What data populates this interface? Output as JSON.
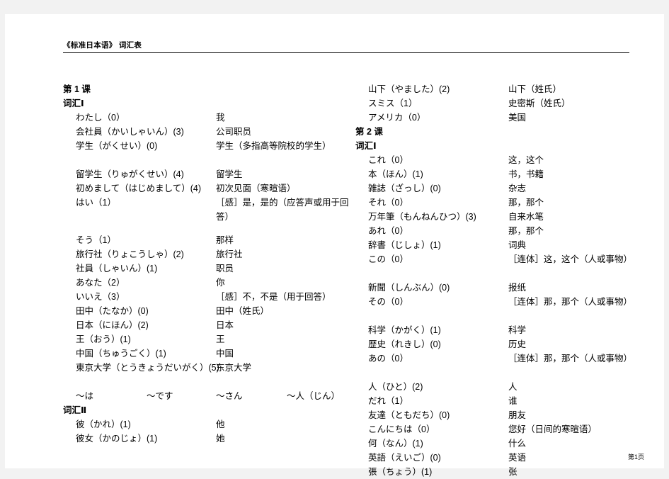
{
  "document": {
    "header_title": "《标准日本语》 词汇表",
    "footer_page": "第1页"
  },
  "left_column": {
    "lesson_heading": "第 1 课",
    "vocab_heading_1": "词汇Ⅰ",
    "vocab_heading_2": "词汇Ⅱ",
    "entries_1": [
      {
        "term": "わたし（0）",
        "gloss": "我"
      },
      {
        "term": "会社員（かいしゃいん）(3)",
        "gloss": "公司职员"
      },
      {
        "term": "学生（がくせい）(0)",
        "gloss": "学生（多指高等院校的学生）"
      },
      {
        "term": "留学生（りゅがくせい）(4)",
        "gloss": "留学生"
      },
      {
        "term": "初めまして（はじめまして）(4)",
        "gloss": "初次见面（寒暄语）"
      },
      {
        "term": "はい（1）",
        "gloss": "［感］是，是的（应答声或用于回答）"
      },
      {
        "term": "そう（1）",
        "gloss": "那样"
      },
      {
        "term": "旅行社（りょこうしゃ）(2)",
        "gloss": "旅行社"
      },
      {
        "term": "社員（しゃいん）(1)",
        "gloss": "职员"
      },
      {
        "term": "あなた（2）",
        "gloss": "你"
      },
      {
        "term": "いいえ（3）",
        "gloss": "［感］不，不是（用于回答）"
      },
      {
        "term": "田中（たなか）(0)",
        "gloss": "田中（姓氏）"
      },
      {
        "term": "日本（にほん）(2)",
        "gloss": "日本"
      },
      {
        "term": "王（おう）(1)",
        "gloss": "王"
      },
      {
        "term": "中国（ちゅうごく）(1)",
        "gloss": "中国"
      },
      {
        "term": "東京大学（とうきょうだいがく）(5)",
        "gloss": "东京大学"
      }
    ],
    "particles": [
      "～は",
      "～です",
      "～さん",
      "～人（じん）"
    ],
    "entries_2": [
      {
        "term": "彼（かれ）(1)",
        "gloss": "他"
      },
      {
        "term": "彼女（かのじょ）(1)",
        "gloss": "她"
      }
    ]
  },
  "right_column": {
    "entries_0": [
      {
        "term": "山下（やました）(2)",
        "gloss": "山下（姓氏）"
      },
      {
        "term": "スミス（1）",
        "gloss": "史密斯（姓氏）"
      },
      {
        "term": "アメリカ（0）",
        "gloss": "美国"
      }
    ],
    "lesson_heading": "第 2 课",
    "vocab_heading_1": "词汇Ⅰ",
    "entries_1": [
      {
        "term": "これ（0）",
        "gloss": "这，这个"
      },
      {
        "term": "本（ほん）(1)",
        "gloss": "书，书籍"
      },
      {
        "term": "雑誌（ざっし）(0)",
        "gloss": "杂志"
      },
      {
        "term": "それ（0）",
        "gloss": "那，那个"
      },
      {
        "term": "万年筆（もんねんひつ）(3)",
        "gloss": "自来水笔"
      },
      {
        "term": "あれ（0）",
        "gloss": "那，那个"
      },
      {
        "term": "辞書（じしょ）(1)",
        "gloss": "词典"
      },
      {
        "term": "この（0）",
        "gloss": "［连体］这，这个（人或事物）"
      },
      {
        "term": "新聞（しんぶん）(0)",
        "gloss": "报纸"
      },
      {
        "term": "その（0）",
        "gloss": "［连体］那，那个（人或事物）"
      },
      {
        "term": "科学（かがく）(1)",
        "gloss": "科学"
      },
      {
        "term": "歴史（れきし）(0)",
        "gloss": "历史"
      },
      {
        "term": "あの（0）",
        "gloss": "［连体］那，那个（人或事物）"
      },
      {
        "term": "人（ひと）(2)",
        "gloss": "人"
      },
      {
        "term": "だれ（1）",
        "gloss": "谁"
      },
      {
        "term": "友達（ともだち）(0)",
        "gloss": "朋友"
      },
      {
        "term": "こんにちは（0）",
        "gloss": "您好（日间的寒暄语）"
      },
      {
        "term": "何（なん）(1)",
        "gloss": "什么"
      },
      {
        "term": "英語（えいご）(0)",
        "gloss": "英语"
      },
      {
        "term": "張（ちょう）(1)",
        "gloss": "张"
      }
    ]
  }
}
